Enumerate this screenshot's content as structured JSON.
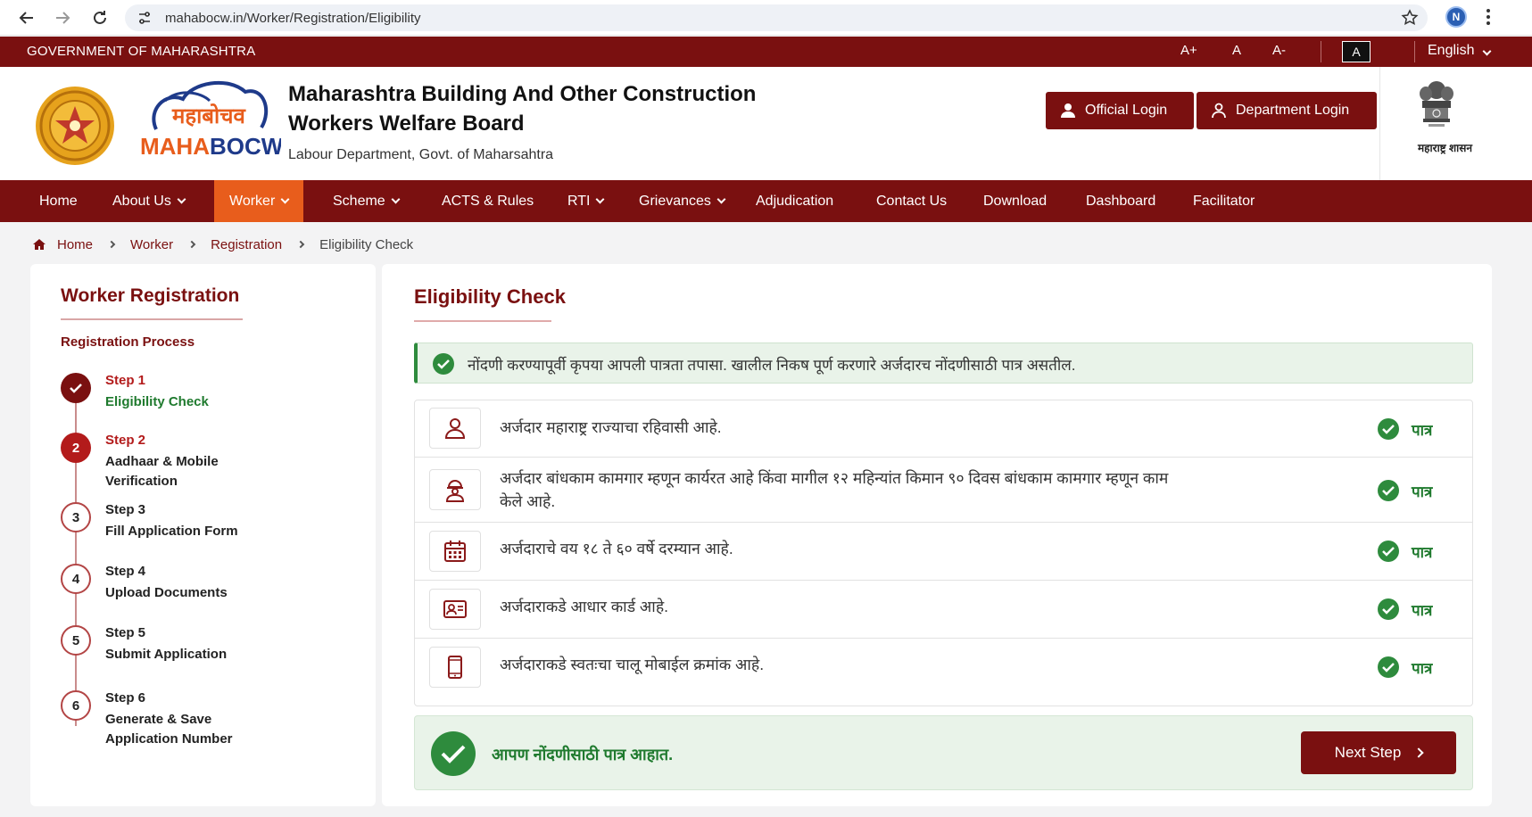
{
  "browser": {
    "url": "mahabocw.in/Worker/Registration/Eligibility",
    "profile_initial": "N"
  },
  "govbar": {
    "title": "GOVERNMENT OF MAHARASHTRA",
    "font_increase": "A+",
    "font_normal": "A",
    "font_decrease": "A-",
    "contrast": "A",
    "language": "English"
  },
  "header": {
    "org_name_line1": "Maharashtra Building And Other Construction",
    "org_name_line2": "Workers Welfare Board",
    "org_sub": "Labour Department, Govt. of Maharsahtra",
    "logo_marathi": "महाबोचव",
    "logo_english": "MAHABOCW",
    "official_login": "Official Login",
    "department_login": "Department Login",
    "gov_emblem_text": "महाराष्ट्र शासन"
  },
  "nav": {
    "items": [
      {
        "label": "Home"
      },
      {
        "label": "About Us"
      },
      {
        "label": "Worker"
      },
      {
        "label": "Scheme"
      },
      {
        "label": "ACTS & Rules"
      },
      {
        "label": "RTI"
      },
      {
        "label": "Grievances"
      },
      {
        "label": "Adjudication"
      },
      {
        "label": "Contact Us"
      },
      {
        "label": "Download"
      },
      {
        "label": "Dashboard"
      },
      {
        "label": "Facilitator"
      }
    ]
  },
  "breadcrumb": {
    "items": [
      "Home",
      "Worker",
      "Registration",
      "Eligibility Check"
    ]
  },
  "sidebar": {
    "title": "Worker Registration",
    "subtitle": "Registration Process",
    "steps": [
      {
        "num_label": "Step 1",
        "name": "Eligibility Check",
        "badge": ""
      },
      {
        "num_label": "Step 2",
        "name": "Aadhaar & Mobile Verification",
        "badge": "2"
      },
      {
        "num_label": "Step 3",
        "name": "Fill Application Form",
        "badge": "3"
      },
      {
        "num_label": "Step 4",
        "name": "Upload Documents",
        "badge": "4"
      },
      {
        "num_label": "Step 5",
        "name": "Submit Application",
        "badge": "5"
      },
      {
        "num_label": "Step 6",
        "name": "Generate & Save Application Number",
        "badge": "6"
      }
    ]
  },
  "main": {
    "title": "Eligibility Check",
    "info": "नोंदणी करण्यापूर्वी कृपया आपली पात्रता तपासा. खालील निकष पूर्ण करणारे अर्जदारच नोंदणीसाठी पात्र असतील.",
    "criteria": [
      {
        "icon": "person-icon",
        "text": "अर्जदार महाराष्ट्र राज्याचा रहिवासी आहे.",
        "status": "पात्र"
      },
      {
        "icon": "construction-worker-icon",
        "text": "अर्जदार बांधकाम कामगार म्हणून कार्यरत आहे किंवा मागील १२ महिन्यांत किमान ९० दिवस बांधकाम कामगार म्हणून काम केले आहे.",
        "status": "पात्र"
      },
      {
        "icon": "calendar-icon",
        "text": "अर्जदाराचे वय १८ ते ६० वर्षे दरम्यान आहे.",
        "status": "पात्र"
      },
      {
        "icon": "id-card-icon",
        "text": "अर्जदाराकडे आधार कार्ड आहे.",
        "status": "पात्र"
      },
      {
        "icon": "mobile-icon",
        "text": "अर्जदाराकडे स्वतःचा चालू मोबाईल क्रमांक आहे.",
        "status": "पात्र"
      }
    ],
    "result_text": "आपण नोंदणीसाठी पात्र आहात.",
    "next_button": "Next Step"
  },
  "colors": {
    "brand_maroon": "#7a1010",
    "active_orange": "#e85d1c",
    "success_green": "#1f7a2e"
  }
}
